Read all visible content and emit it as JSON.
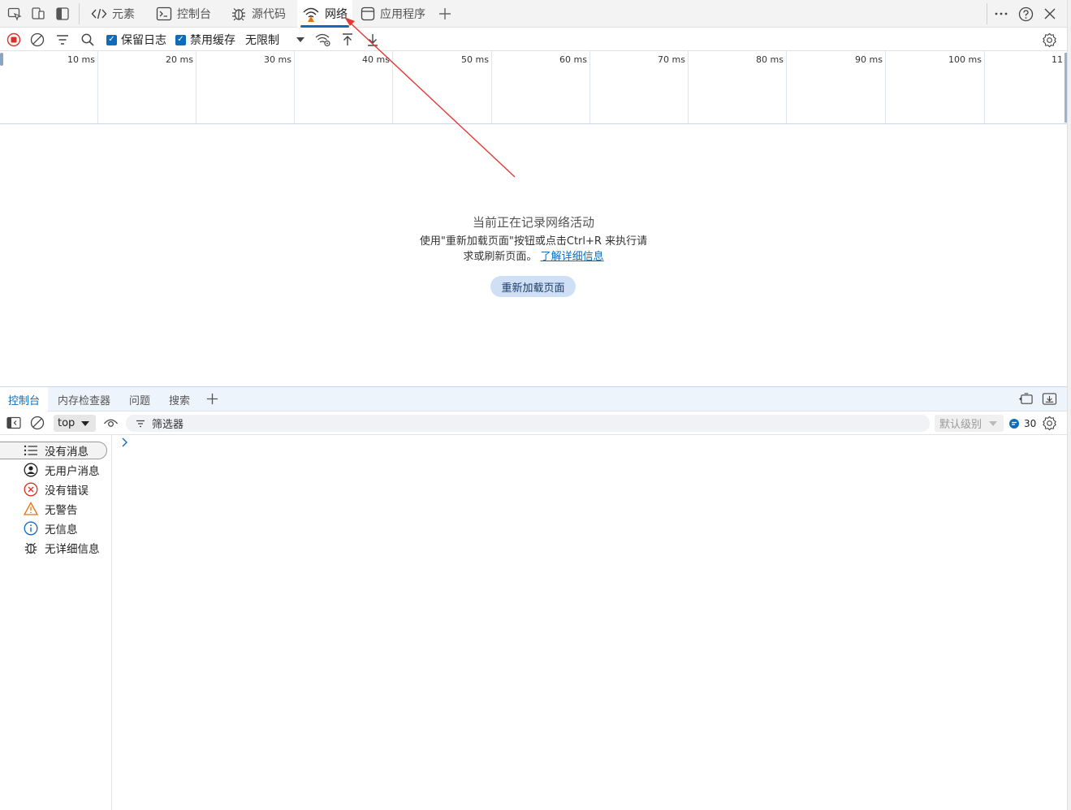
{
  "tabs": {
    "elements": "元素",
    "console": "控制台",
    "sources": "源代码",
    "network": "网络",
    "application": "应用程序"
  },
  "network_toolbar": {
    "preserve_log": "保留日志",
    "disable_cache": "禁用缓存",
    "throttling": "无限制"
  },
  "timeline": {
    "ticks": [
      "10 ms",
      "20 ms",
      "30 ms",
      "40 ms",
      "50 ms",
      "60 ms",
      "70 ms",
      "80 ms",
      "90 ms",
      "100 ms",
      "11"
    ]
  },
  "empty_state": {
    "title": "当前正在记录网络活动",
    "desc_line1": "使用\"重新加载页面\"按钮或点击Ctrl+R 来执行请",
    "desc_line2": "求或刷新页面。",
    "learn_more": "了解详细信息",
    "reload_button": "重新加载页面"
  },
  "drawer": {
    "tabs": [
      "控制台",
      "内存检查器",
      "问题",
      "搜索"
    ]
  },
  "console_toolbar": {
    "context": "top",
    "filter_placeholder": "筛选器",
    "level": "默认级别",
    "message_count": "30"
  },
  "sidebar": {
    "items": [
      {
        "label": "没有消息",
        "icon": "list-icon"
      },
      {
        "label": "无用户消息",
        "icon": "user-icon"
      },
      {
        "label": "没有错误",
        "icon": "error-icon"
      },
      {
        "label": "无警告",
        "icon": "warning-icon"
      },
      {
        "label": "无信息",
        "icon": "info-icon"
      },
      {
        "label": "无详细信息",
        "icon": "bug-icon"
      }
    ]
  },
  "colors": {
    "accent": "#0f6cbd",
    "record_red": "#d93025",
    "annotation_red": "#e53935"
  }
}
